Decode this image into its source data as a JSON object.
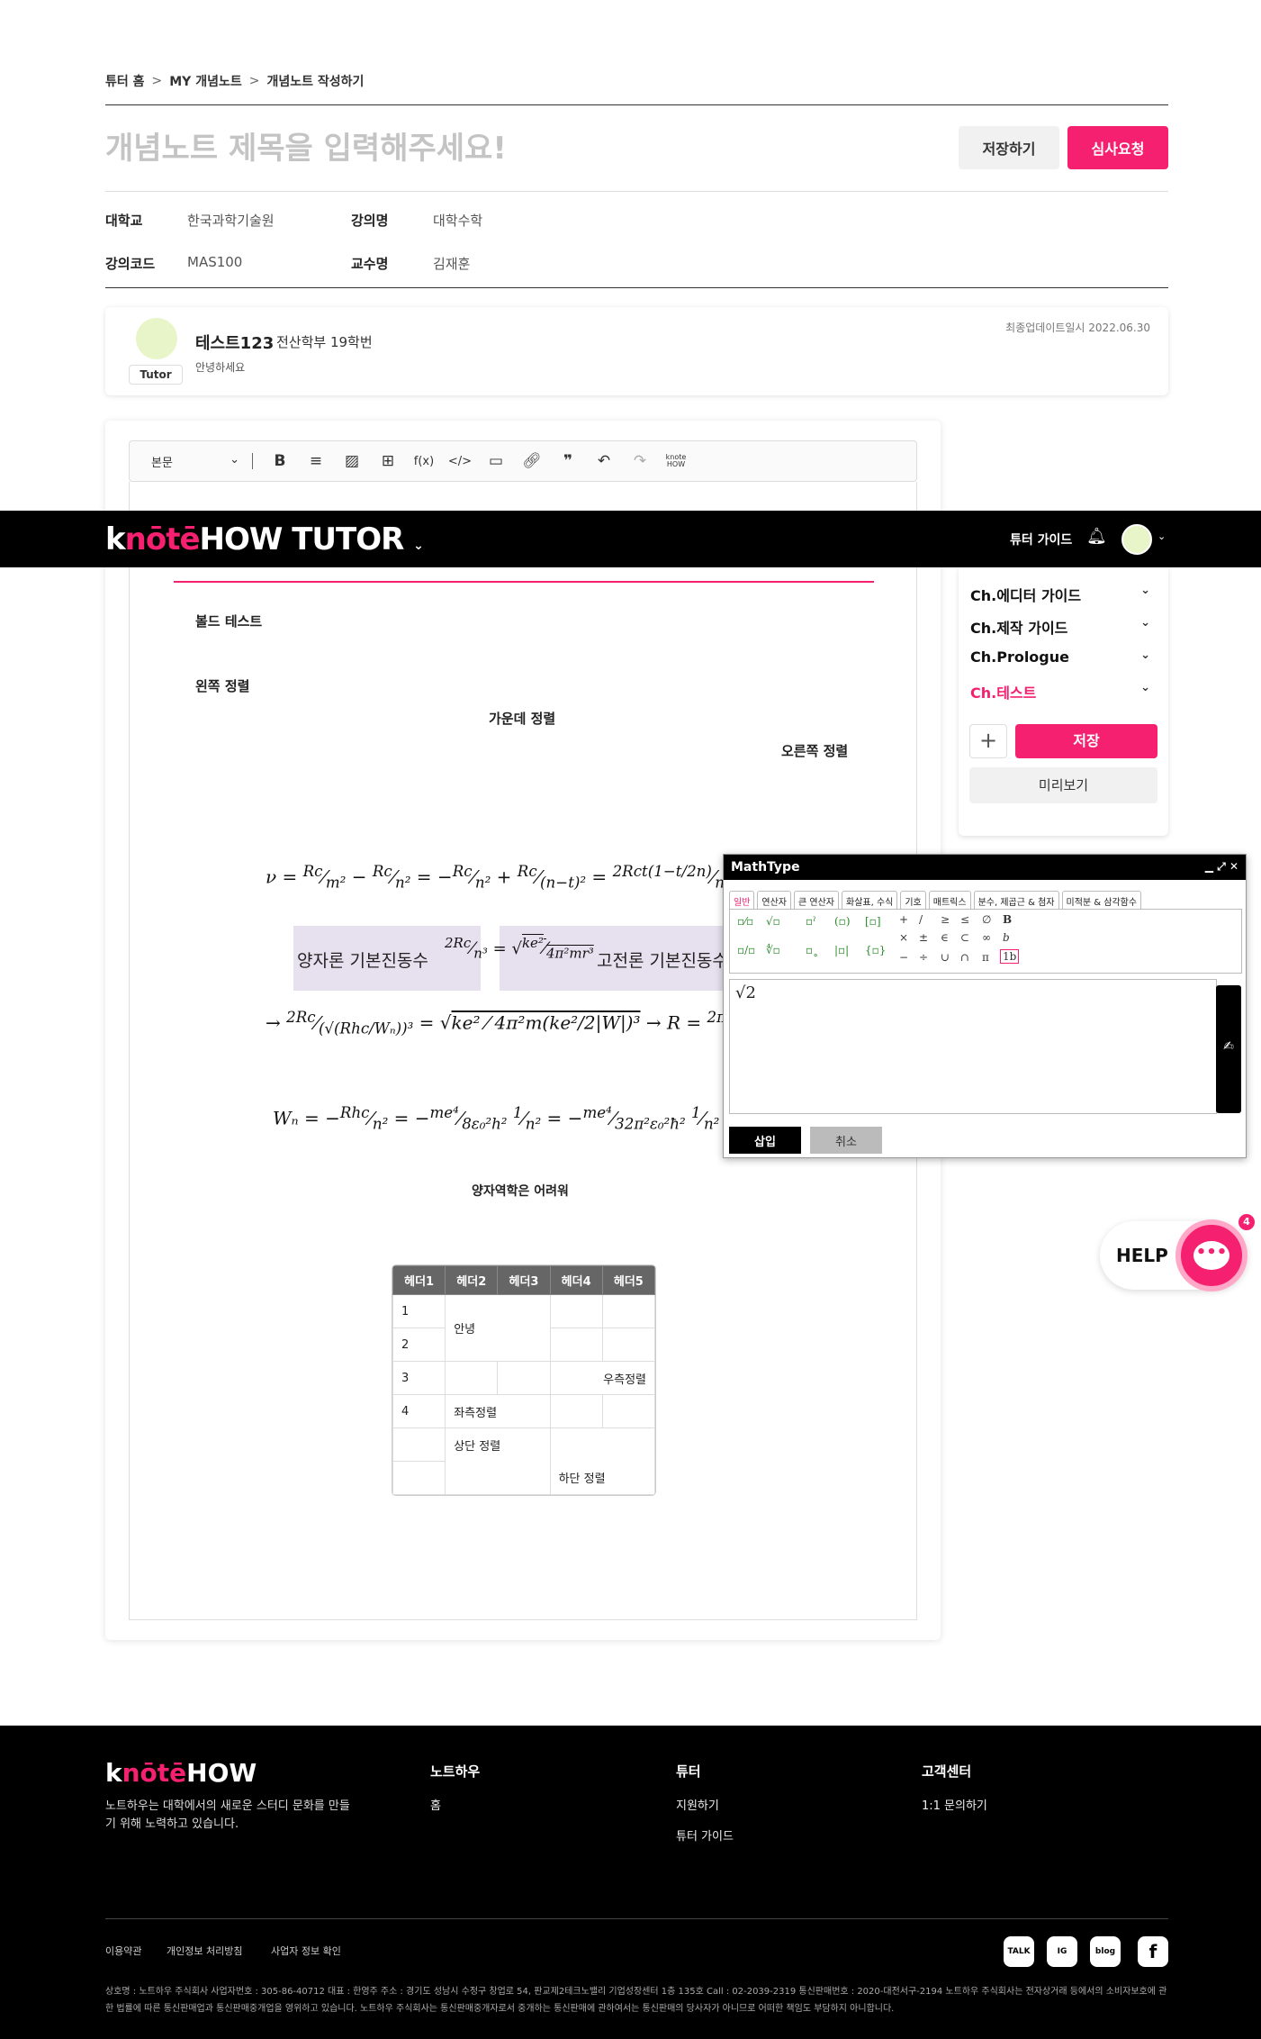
{
  "breadcrumb": [
    "튜터 홈",
    "MY 개념노트",
    "개념노트 작성하기"
  ],
  "title_placeholder": "개념노트 제목을 입력해주세요!",
  "buttons": {
    "save": "저장하기",
    "review": "심사요청"
  },
  "info": {
    "university_label": "대학교",
    "university": "한국과학기술원",
    "lecture_label": "강의명",
    "lecture": "대학수학",
    "code_label": "강의코드",
    "code": "MAS100",
    "professor_label": "교수명",
    "professor": "김재훈"
  },
  "profile": {
    "badge": "Tutor",
    "name": "테스트123",
    "dept": "전산학부 19학번",
    "greeting": "안녕하세요",
    "updated": "최종업데이트일시 2022.06.30"
  },
  "toolbar": {
    "style_select": "본문",
    "fx": "f(x)",
    "code": "</>",
    "knote": "knote HOW"
  },
  "nav": {
    "logo_a": "k",
    "logo_note": "nōtē",
    "logo_b": "HOW TUTOR",
    "guide": "튜터 가이드"
  },
  "doc": {
    "bold": "볼드 테스트",
    "left": "왼쪽 정렬",
    "center": "가운데 정렬",
    "right": "오른쪽 정렬",
    "quantum_caption": "양자역학은 어려워",
    "quantum_label": "양자론 기본진동수",
    "classical_label": "고전론 기본진동수"
  },
  "side": {
    "chapters": [
      "Ch.에디터 가이드",
      "Ch.제작 가이드",
      "Ch.Prologue",
      "Ch.테스트"
    ],
    "save": "저장",
    "preview": "미리보기"
  },
  "mathtype": {
    "title": "MathType",
    "tabs": [
      "일반",
      "연산자",
      "큰 연산자",
      "화살표, 수식",
      "기호",
      "매트릭스",
      "분수, 제곱근 & 첨자",
      "미적분 & 삼각함수"
    ],
    "content": "√2",
    "insert": "삽입",
    "cancel": "취소"
  },
  "table": {
    "headers": [
      "헤더1",
      "헤더2",
      "헤더3",
      "헤더4",
      "헤더5"
    ],
    "r1c1": "1",
    "r2c1": "2",
    "merged_notice": "안녕",
    "r3c1": "3",
    "right_align": "우측정렬",
    "r4c1": "4",
    "left_align": "좌측정렬",
    "top_align": "상단 정렬",
    "bottom_align": "하단 정렬"
  },
  "help": {
    "label": "HELP",
    "badge": "4"
  },
  "footer": {
    "logo_a": "k",
    "logo_note": "nōtē",
    "logo_b": "HOW",
    "desc": "노트하우는 대학에서의 새로운 스터디 문화를 만들기 위해 노력하고 있습니다.",
    "col1_title": "노트하우",
    "col1_link1": "홈",
    "col2_title": "튜터",
    "col2_link1": "지원하기",
    "col2_link2": "튜터 가이드",
    "col3_title": "고객센터",
    "col3_link1": "1:1 문의하기",
    "terms": "이용약관",
    "privacy": "개인정보 처리방침",
    "bizinfo": "사업자 정보 확인",
    "legal": "상호명 : 노트하우 주식회사 사업자번호 : 305-86-40712 대표 : 한영주 주소 : 경기도 성남시 수정구 창업로 54, 판교제2테크노밸리 기업성장센터 1층 135호 Call : 02-2039-2319 통신판매번호 : 2020-대전서구-2194 노트하우 주식회사는 전자상거래 등에서의 소비자보호에 관한 법률에 따른 통신판매업과 통신판매중개업을 영위하고 있습니다. 노트하우 주식회사는 통신판매중개자로서 중개하는 통신판매에 관하여서는 통신판매의 당사자가 아니므로 어떠한 책임도 부담하지 아니합니다.",
    "social": [
      "TALK",
      "IG",
      "blog",
      "f"
    ]
  }
}
